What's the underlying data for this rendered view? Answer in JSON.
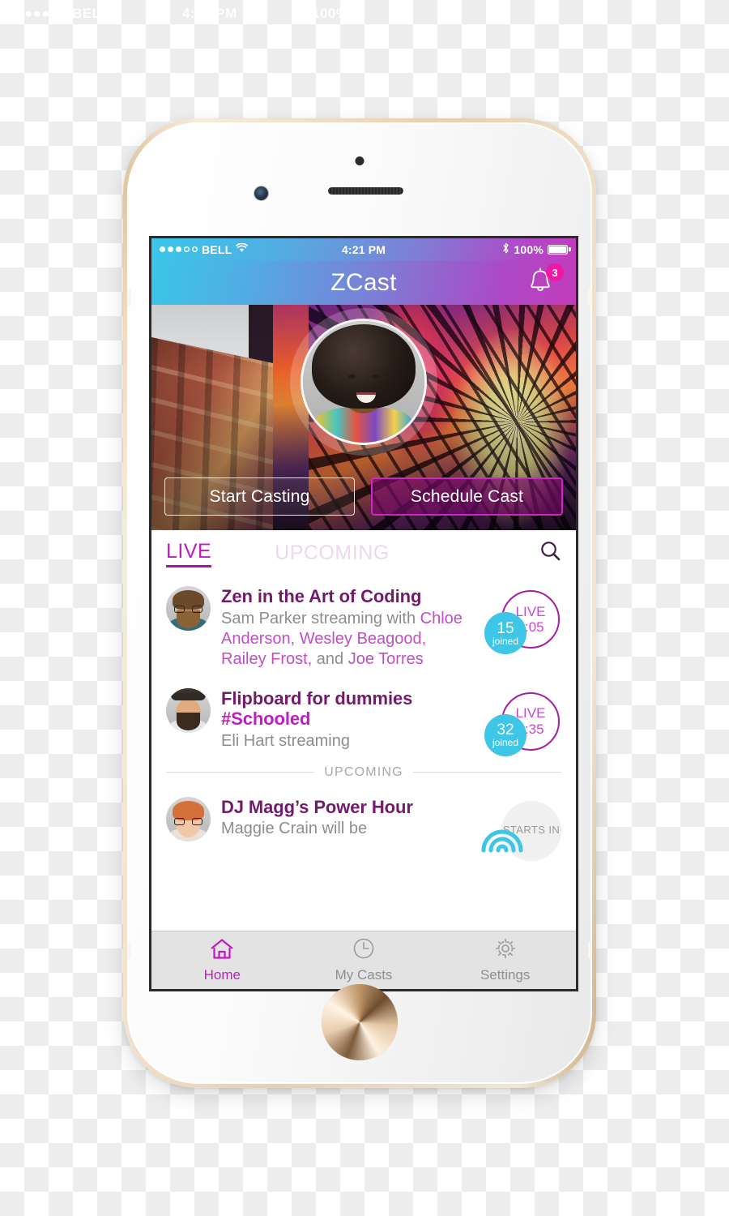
{
  "backdrop": {
    "ghost_watermark": {
      "left": "●●●○○ BELL",
      "center": "4:21 PM",
      "right": "100%"
    }
  },
  "device": {
    "name": "iphone-6-gold",
    "color": "#efdcc0"
  },
  "status_bar": {
    "carrier": "BELL",
    "signal_filled": 3,
    "signal_hollow": 2,
    "wifi_icon": "wifi-icon",
    "time": "4:21 PM",
    "bluetooth_icon": "bluetooth-icon",
    "battery_percent": "100%"
  },
  "nav_bar": {
    "title": "ZCast",
    "notifications_icon": "bell-icon",
    "notifications_count": "3",
    "gradient_from": "#3ac6e8",
    "gradient_to": "#c23cbc",
    "badge_color": "#f216a8"
  },
  "hero": {
    "avatar_alt": "user-avatar",
    "buttons": [
      {
        "label": "Start Casting",
        "style": "ghost",
        "name": "start-casting-button"
      },
      {
        "label": "Schedule Cast",
        "style": "solid",
        "name": "schedule-cast-button"
      }
    ]
  },
  "tabs": {
    "live_label": "LIVE",
    "upcoming_label": "UPCOMING",
    "active": "LIVE",
    "search_icon": "search-icon",
    "active_color": "#c21bc4",
    "inactive_color": "#edd9ef"
  },
  "feed": {
    "section_divider_label": "UPCOMING",
    "items": [
      {
        "id": "zen-in-the-art-of-coding",
        "avatar": "bearded-man-glasses",
        "title": "Zen in the Art of Coding",
        "subtitle_prefix": "Sam Parker streaming with ",
        "guests": "Chloe Anderson, Wesley Beagood, Railey Frost,",
        "subtitle_mid": " and ",
        "guests_2": "Joe Torres",
        "status": "LIVE",
        "time": "1:05",
        "joined_count": "15",
        "joined_label": "joined",
        "state": "live"
      },
      {
        "id": "flipboard-for-dummies",
        "avatar": "hat-man-mustache",
        "title": "Flipboard for dummies",
        "hashtag": "#Schooled",
        "subtitle_prefix": "Eli Hart streaming",
        "status": "LIVE",
        "time": "2:35",
        "joined_count": "32",
        "joined_label": "joined",
        "state": "live"
      },
      {
        "id": "dj-maggs-power-hour",
        "avatar": "redhead-woman-glasses",
        "title": "DJ Magg’s Power Hour",
        "subtitle_prefix": "Maggie Crain will be",
        "status_line_1": "STARTS IN",
        "state": "upcoming"
      }
    ],
    "live_color": "#a31fa6",
    "joined_color": "#3dc6e6",
    "title_color": "#701c6b",
    "guest_color": "#c14ec4"
  },
  "tab_bar": {
    "items": [
      {
        "label": "Home",
        "icon": "home-icon",
        "active": true
      },
      {
        "label": "My Casts",
        "icon": "clock-icon",
        "active": false
      },
      {
        "label": "Settings",
        "icon": "gear-icon",
        "active": false
      }
    ]
  }
}
